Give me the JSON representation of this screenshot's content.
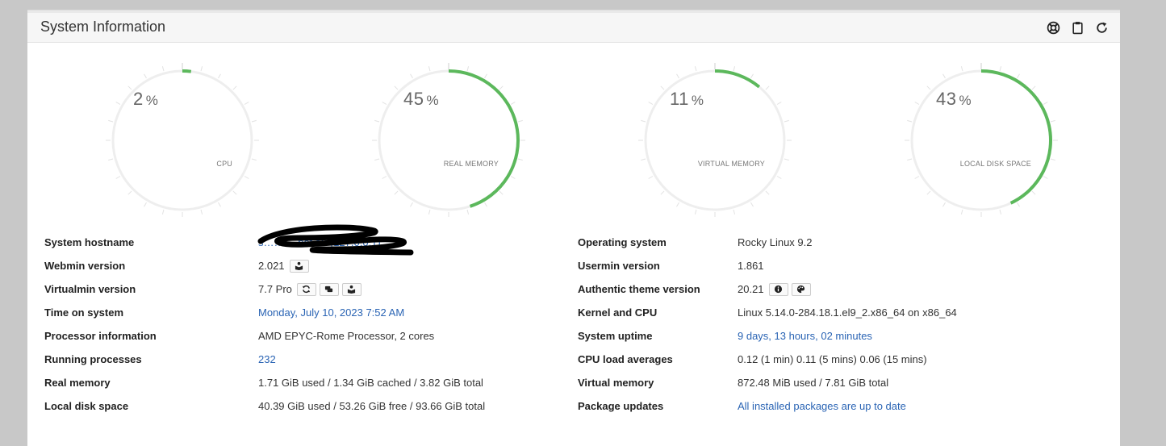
{
  "panel": {
    "title": "System Information"
  },
  "header_icons": [
    "lifebuoy-icon",
    "clipboard-icon",
    "refresh-icon"
  ],
  "gauges": [
    {
      "value": "2",
      "unit": "%",
      "label": "CPU",
      "percent": 0.02
    },
    {
      "value": "45",
      "unit": "%",
      "label": "REAL MEMORY",
      "percent": 0.45
    },
    {
      "value": "11",
      "unit": "%",
      "label": "VIRTUAL MEMORY",
      "percent": 0.11
    },
    {
      "value": "43",
      "unit": "%",
      "label": "LOCAL DISK SPACE",
      "percent": 0.43
    }
  ],
  "colors": {
    "gauge_fill": "#5cb85c",
    "gauge_track": "#eeeeee",
    "link": "#2a64b4"
  },
  "left": {
    "hostname": {
      "label": "System hostname",
      "value": "s……….net.au (127.0.0.1)"
    },
    "webmin": {
      "label": "Webmin version",
      "value": "2.021"
    },
    "virtualmin": {
      "label": "Virtualmin version",
      "value": "7.7 Pro"
    },
    "time": {
      "label": "Time on system",
      "value": "Monday, July 10, 2023 7:52 AM"
    },
    "processor": {
      "label": "Processor information",
      "value": "AMD EPYC-Rome Processor, 2 cores"
    },
    "processes": {
      "label": "Running processes",
      "value": "232"
    },
    "realmem": {
      "label": "Real memory",
      "value": "1.71 GiB used / 1.34 GiB cached / 3.82 GiB total"
    },
    "disk": {
      "label": "Local disk space",
      "value": "40.39 GiB used / 53.26 GiB free / 93.66 GiB total"
    }
  },
  "right": {
    "os": {
      "label": "Operating system",
      "value": "Rocky Linux 9.2"
    },
    "usermin": {
      "label": "Usermin version",
      "value": "1.861"
    },
    "theme": {
      "label": "Authentic theme version",
      "value": "20.21"
    },
    "kernel": {
      "label": "Kernel and CPU",
      "value": "Linux 5.14.0-284.18.1.el9_2.x86_64 on x86_64"
    },
    "uptime": {
      "label": "System uptime",
      "value": "9 days, 13 hours, 02 minutes"
    },
    "load": {
      "label": "CPU load averages",
      "value": "0.12 (1 min) 0.11 (5 mins) 0.06 (15 mins)"
    },
    "virtmem": {
      "label": "Virtual memory",
      "value": "872.48 MiB used / 7.81 GiB total"
    },
    "updates": {
      "label": "Package updates",
      "value": "All installed packages are up to date"
    }
  }
}
